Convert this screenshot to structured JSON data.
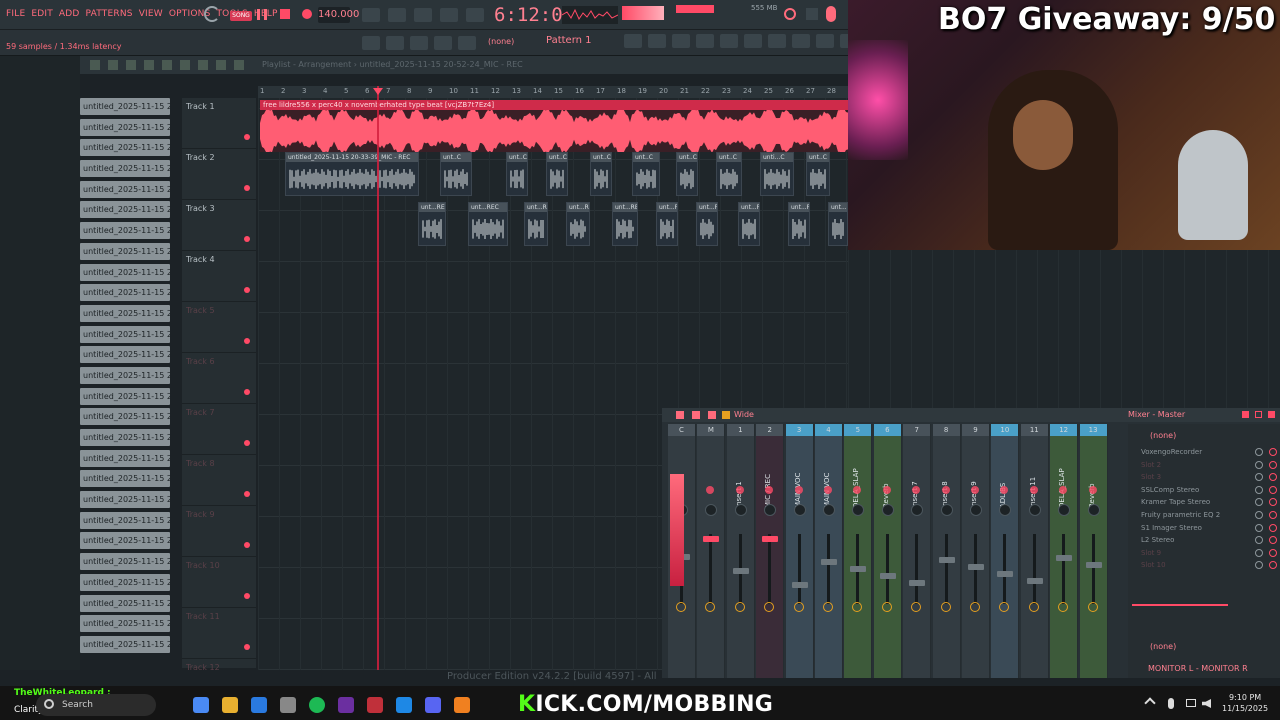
{
  "top": {
    "menus": [
      "FILE",
      "EDIT",
      "ADD",
      "PATTERNS",
      "VIEW",
      "OPTIONS",
      "TOOLS",
      "HELP"
    ],
    "mode": "SONG",
    "tempo": "140.000",
    "time": "6:12:05",
    "memory": "555 MB",
    "latency": "59 samples / 1.34ms latency",
    "pattern": "Pattern 1",
    "none": "(none)"
  },
  "playlist": {
    "title": "Playlist - Arrangement › untitled_2025-11-15 20-52-24_MIC - REC",
    "ruler": [
      "1",
      "2",
      "3",
      "4",
      "5",
      "6",
      "7",
      "8",
      "9",
      "10",
      "11",
      "12",
      "13",
      "14",
      "15",
      "16",
      "17",
      "18",
      "19",
      "20",
      "21",
      "22",
      "23",
      "24",
      "25",
      "26",
      "27",
      "28"
    ],
    "tracks": [
      "Track 1",
      "Track 2",
      "Track 3",
      "Track 4",
      "Track 5",
      "Track 6",
      "Track 7",
      "Track 8",
      "Track 9",
      "Track 10",
      "Track 11",
      "Track 12"
    ],
    "patterns": [
      "untitled_2025-11-15 20-",
      "untitled_2025-11-15 20-",
      "untitled_2025-11-15 20-",
      "untitled_2025-11-15 20-",
      "untitled_2025-11-15 20-",
      "untitled_2025-11-15 20-",
      "untitled_2025-11-15 20-",
      "untitled_2025-11-15 20-",
      "untitled_2025-11-15 20-",
      "untitled_2025-11-15 20-",
      "untitled_2025-11-15 20-",
      "untitled_2025-11-15 20-",
      "untitled_2025-11-15 20-",
      "untitled_2025-11-15 20-",
      "untitled_2025-11-15 20-",
      "untitled_2025-11-15 20-",
      "untitled_2025-11-15 20-",
      "untitled_2025-11-15 20-",
      "untitled_2025-11-15 20-",
      "untitled_2025-11-15 20-",
      "untitled_2025-11-15 20-",
      "untitled_2025-11-15 20-",
      "untitled_2025-11-15 20-",
      "untitled_2025-11-15 20-",
      "untitled_2025-11-15 20-",
      "untitled_2025-11-15 20-",
      "untitled_2025-11-15 20-"
    ],
    "beat_clip": "free lildre556 x perc40 x novemberhated type beat [vcjZB7t7Ez4]",
    "clip_track2": "untitled_2025-11-15 20-33-39_MIC - REC",
    "clip_short": "unt..C",
    "clip_short2": "unt...REC",
    "clip_short3": "unti...C"
  },
  "stream": {
    "giveaway": "BO7 Giveaway: 9/50",
    "kick": "KICK.COM/MOBBING",
    "chat_user": "TheWhiteLeopard :",
    "chat_user2": "Clarity :"
  },
  "mixer": {
    "title": "Mixer - Master",
    "view": "Wide",
    "channels": [
      {
        "num": "C",
        "name": ""
      },
      {
        "num": "M",
        "name": ""
      },
      {
        "num": "1",
        "name": "Insert 1"
      },
      {
        "num": "2",
        "name": "MIC / REC"
      },
      {
        "num": "3",
        "name": "MAIN VOC"
      },
      {
        "num": "4",
        "name": "MAIN VOC"
      },
      {
        "num": "5",
        "name": "DELA_SLAP"
      },
      {
        "num": "6",
        "name": "Reverb"
      },
      {
        "num": "7",
        "name": "Insert 7"
      },
      {
        "num": "8",
        "name": "Insert 8"
      },
      {
        "num": "9",
        "name": "Insert 9"
      },
      {
        "num": "10",
        "name": "ADLIBS"
      },
      {
        "num": "11",
        "name": "Insert 11"
      },
      {
        "num": "12",
        "name": "DELA_SLAP"
      },
      {
        "num": "13",
        "name": "Reverb"
      }
    ],
    "fx": [
      "VoxengoRecorder",
      "Slot 2",
      "Slot 3",
      "SSLComp Stereo",
      "Kramer Tape Stereo",
      "Fruity parametric EQ 2",
      "S1 Imager Stereo",
      "L2 Stereo",
      "Slot 9",
      "Slot 10"
    ],
    "fx_none_top": "(none)",
    "fx_none_bottom": "(none)",
    "monitor": "MONITOR L - MONITOR R"
  },
  "status": "Producer Edition v24.2.2 [build 4597] - All",
  "taskbar": {
    "search": "Search",
    "time": "9:10 PM",
    "date": "11/15/2025"
  },
  "colors": {
    "accent": "#ff4a66",
    "waveform": "#ff5d73",
    "kick": "#53fc18"
  }
}
